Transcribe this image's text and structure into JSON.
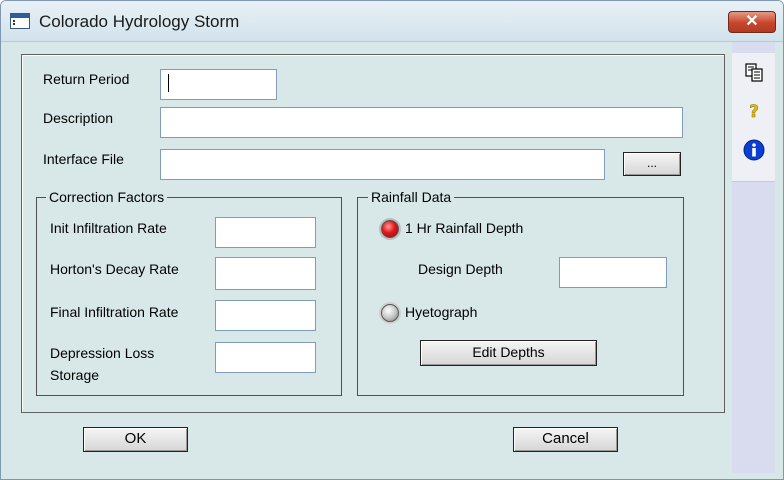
{
  "window": {
    "title": "Colorado Hydrology Storm",
    "close_label": "✕"
  },
  "form": {
    "return_period": {
      "label": "Return Period",
      "value": ""
    },
    "description": {
      "label": "Description",
      "value": ""
    },
    "interface_file": {
      "label": "Interface File",
      "value": "",
      "browse_label": "..."
    }
  },
  "correction_factors": {
    "title": "Correction Factors",
    "init_infiltration_rate": {
      "label": "Init Infiltration Rate",
      "value": ""
    },
    "hortons_decay_rate": {
      "label": "Horton's Decay Rate",
      "value": ""
    },
    "final_infiltration_rate": {
      "label": "Final Infiltration Rate",
      "value": ""
    },
    "depression_loss_storage": {
      "label_line1": "Depression Loss",
      "label_line2": "Storage",
      "value": ""
    }
  },
  "rainfall_data": {
    "title": "Rainfall Data",
    "option_1hr": {
      "label": "1 Hr Rainfall Depth",
      "selected": true
    },
    "design_depth": {
      "label": "Design Depth",
      "value": ""
    },
    "option_hyetograph": {
      "label": "Hyetograph",
      "selected": false
    },
    "edit_depths_label": "Edit Depths"
  },
  "buttons": {
    "ok_label": "OK",
    "cancel_label": "Cancel"
  },
  "toolbar": {
    "icons": [
      "copy-icon",
      "help-icon",
      "info-icon"
    ]
  }
}
